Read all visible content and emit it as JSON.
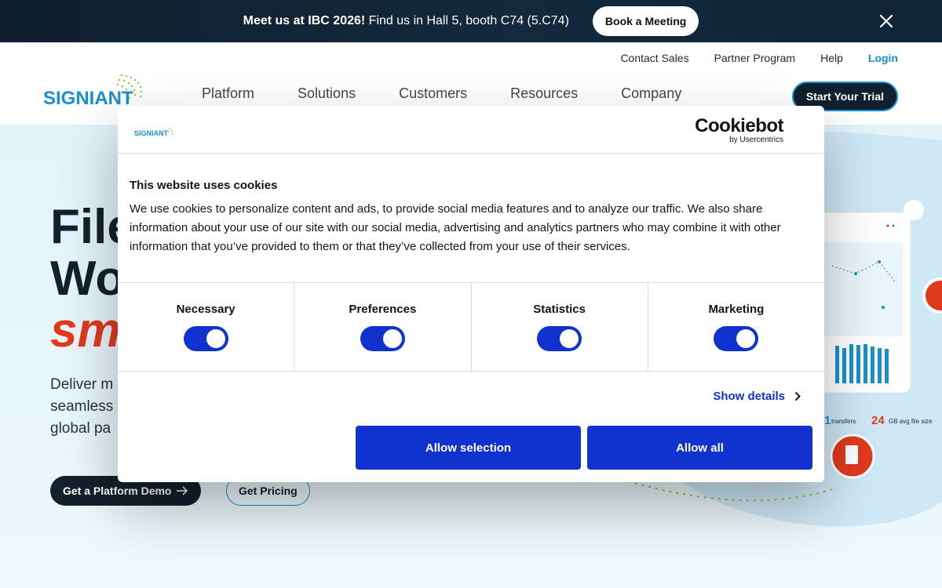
{
  "announcement": {
    "bold": "Meet us at IBC 2026!",
    "text": " Find us in Hall 5, booth C74 (5.C74)",
    "button": "Book a Meeting",
    "close_icon": "close-icon"
  },
  "header": {
    "logo_text": "SIGNIANT",
    "utility_nav": [
      "Contact Sales",
      "Partner Program",
      "Help",
      "Login"
    ],
    "main_nav": [
      "Platform",
      "Solutions",
      "Customers",
      "Resources",
      "Company"
    ],
    "trial_button": "Start Your Trial"
  },
  "hero": {
    "title_line1": "File",
    "title_line2": "Wo",
    "title_line3": "sma",
    "subtitle_line1": "Deliver m",
    "subtitle_line2": "seamless",
    "subtitle_line3": "global pa",
    "demo_button": "Get a Platform Demo",
    "pricing_button": "Get Pricing",
    "stats": {
      "transfers_value": "1",
      "transfers_label": "transfers",
      "avg_value": "24",
      "avg_label": "GB avg file size"
    }
  },
  "cookie": {
    "logo_text": "SIGNIANT",
    "brand": "Cookiebot",
    "brand_sub": "by Usercentrics",
    "title": "This website uses cookies",
    "text": "We use cookies to personalize content and ads, to provide social media features and to analyze our traffic. We also share information about your use of our site with our social media, advertising and analytics partners who may combine it with other information that you’ve provided to them or that they’ve collected from your use of their services.",
    "toggles": [
      {
        "label": "Necessary",
        "on": true
      },
      {
        "label": "Preferences",
        "on": true
      },
      {
        "label": "Statistics",
        "on": true
      },
      {
        "label": "Marketing",
        "on": true
      }
    ],
    "show_details": "Show details",
    "allow_selection": "Allow selection",
    "allow_all": "Allow all"
  },
  "colors": {
    "brand_blue": "#1a8fd0",
    "cookie_blue": "#1032cf",
    "accent_red": "#e03a1e",
    "dark": "#14202c"
  }
}
